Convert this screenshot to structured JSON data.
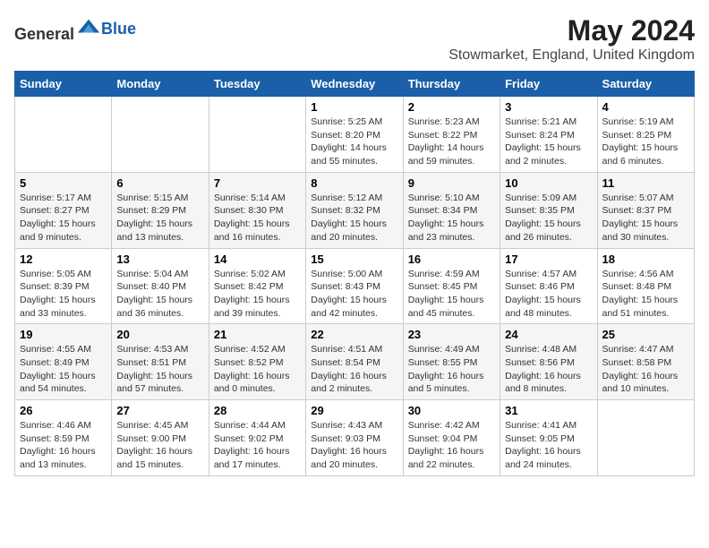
{
  "header": {
    "logo_general": "General",
    "logo_blue": "Blue",
    "month": "May 2024",
    "location": "Stowmarket, England, United Kingdom"
  },
  "weekdays": [
    "Sunday",
    "Monday",
    "Tuesday",
    "Wednesday",
    "Thursday",
    "Friday",
    "Saturday"
  ],
  "weeks": [
    [
      {
        "day": "",
        "info": ""
      },
      {
        "day": "",
        "info": ""
      },
      {
        "day": "",
        "info": ""
      },
      {
        "day": "1",
        "info": "Sunrise: 5:25 AM\nSunset: 8:20 PM\nDaylight: 14 hours\nand 55 minutes."
      },
      {
        "day": "2",
        "info": "Sunrise: 5:23 AM\nSunset: 8:22 PM\nDaylight: 14 hours\nand 59 minutes."
      },
      {
        "day": "3",
        "info": "Sunrise: 5:21 AM\nSunset: 8:24 PM\nDaylight: 15 hours\nand 2 minutes."
      },
      {
        "day": "4",
        "info": "Sunrise: 5:19 AM\nSunset: 8:25 PM\nDaylight: 15 hours\nand 6 minutes."
      }
    ],
    [
      {
        "day": "5",
        "info": "Sunrise: 5:17 AM\nSunset: 8:27 PM\nDaylight: 15 hours\nand 9 minutes."
      },
      {
        "day": "6",
        "info": "Sunrise: 5:15 AM\nSunset: 8:29 PM\nDaylight: 15 hours\nand 13 minutes."
      },
      {
        "day": "7",
        "info": "Sunrise: 5:14 AM\nSunset: 8:30 PM\nDaylight: 15 hours\nand 16 minutes."
      },
      {
        "day": "8",
        "info": "Sunrise: 5:12 AM\nSunset: 8:32 PM\nDaylight: 15 hours\nand 20 minutes."
      },
      {
        "day": "9",
        "info": "Sunrise: 5:10 AM\nSunset: 8:34 PM\nDaylight: 15 hours\nand 23 minutes."
      },
      {
        "day": "10",
        "info": "Sunrise: 5:09 AM\nSunset: 8:35 PM\nDaylight: 15 hours\nand 26 minutes."
      },
      {
        "day": "11",
        "info": "Sunrise: 5:07 AM\nSunset: 8:37 PM\nDaylight: 15 hours\nand 30 minutes."
      }
    ],
    [
      {
        "day": "12",
        "info": "Sunrise: 5:05 AM\nSunset: 8:39 PM\nDaylight: 15 hours\nand 33 minutes."
      },
      {
        "day": "13",
        "info": "Sunrise: 5:04 AM\nSunset: 8:40 PM\nDaylight: 15 hours\nand 36 minutes."
      },
      {
        "day": "14",
        "info": "Sunrise: 5:02 AM\nSunset: 8:42 PM\nDaylight: 15 hours\nand 39 minutes."
      },
      {
        "day": "15",
        "info": "Sunrise: 5:00 AM\nSunset: 8:43 PM\nDaylight: 15 hours\nand 42 minutes."
      },
      {
        "day": "16",
        "info": "Sunrise: 4:59 AM\nSunset: 8:45 PM\nDaylight: 15 hours\nand 45 minutes."
      },
      {
        "day": "17",
        "info": "Sunrise: 4:57 AM\nSunset: 8:46 PM\nDaylight: 15 hours\nand 48 minutes."
      },
      {
        "day": "18",
        "info": "Sunrise: 4:56 AM\nSunset: 8:48 PM\nDaylight: 15 hours\nand 51 minutes."
      }
    ],
    [
      {
        "day": "19",
        "info": "Sunrise: 4:55 AM\nSunset: 8:49 PM\nDaylight: 15 hours\nand 54 minutes."
      },
      {
        "day": "20",
        "info": "Sunrise: 4:53 AM\nSunset: 8:51 PM\nDaylight: 15 hours\nand 57 minutes."
      },
      {
        "day": "21",
        "info": "Sunrise: 4:52 AM\nSunset: 8:52 PM\nDaylight: 16 hours\nand 0 minutes."
      },
      {
        "day": "22",
        "info": "Sunrise: 4:51 AM\nSunset: 8:54 PM\nDaylight: 16 hours\nand 2 minutes."
      },
      {
        "day": "23",
        "info": "Sunrise: 4:49 AM\nSunset: 8:55 PM\nDaylight: 16 hours\nand 5 minutes."
      },
      {
        "day": "24",
        "info": "Sunrise: 4:48 AM\nSunset: 8:56 PM\nDaylight: 16 hours\nand 8 minutes."
      },
      {
        "day": "25",
        "info": "Sunrise: 4:47 AM\nSunset: 8:58 PM\nDaylight: 16 hours\nand 10 minutes."
      }
    ],
    [
      {
        "day": "26",
        "info": "Sunrise: 4:46 AM\nSunset: 8:59 PM\nDaylight: 16 hours\nand 13 minutes."
      },
      {
        "day": "27",
        "info": "Sunrise: 4:45 AM\nSunset: 9:00 PM\nDaylight: 16 hours\nand 15 minutes."
      },
      {
        "day": "28",
        "info": "Sunrise: 4:44 AM\nSunset: 9:02 PM\nDaylight: 16 hours\nand 17 minutes."
      },
      {
        "day": "29",
        "info": "Sunrise: 4:43 AM\nSunset: 9:03 PM\nDaylight: 16 hours\nand 20 minutes."
      },
      {
        "day": "30",
        "info": "Sunrise: 4:42 AM\nSunset: 9:04 PM\nDaylight: 16 hours\nand 22 minutes."
      },
      {
        "day": "31",
        "info": "Sunrise: 4:41 AM\nSunset: 9:05 PM\nDaylight: 16 hours\nand 24 minutes."
      },
      {
        "day": "",
        "info": ""
      }
    ]
  ]
}
